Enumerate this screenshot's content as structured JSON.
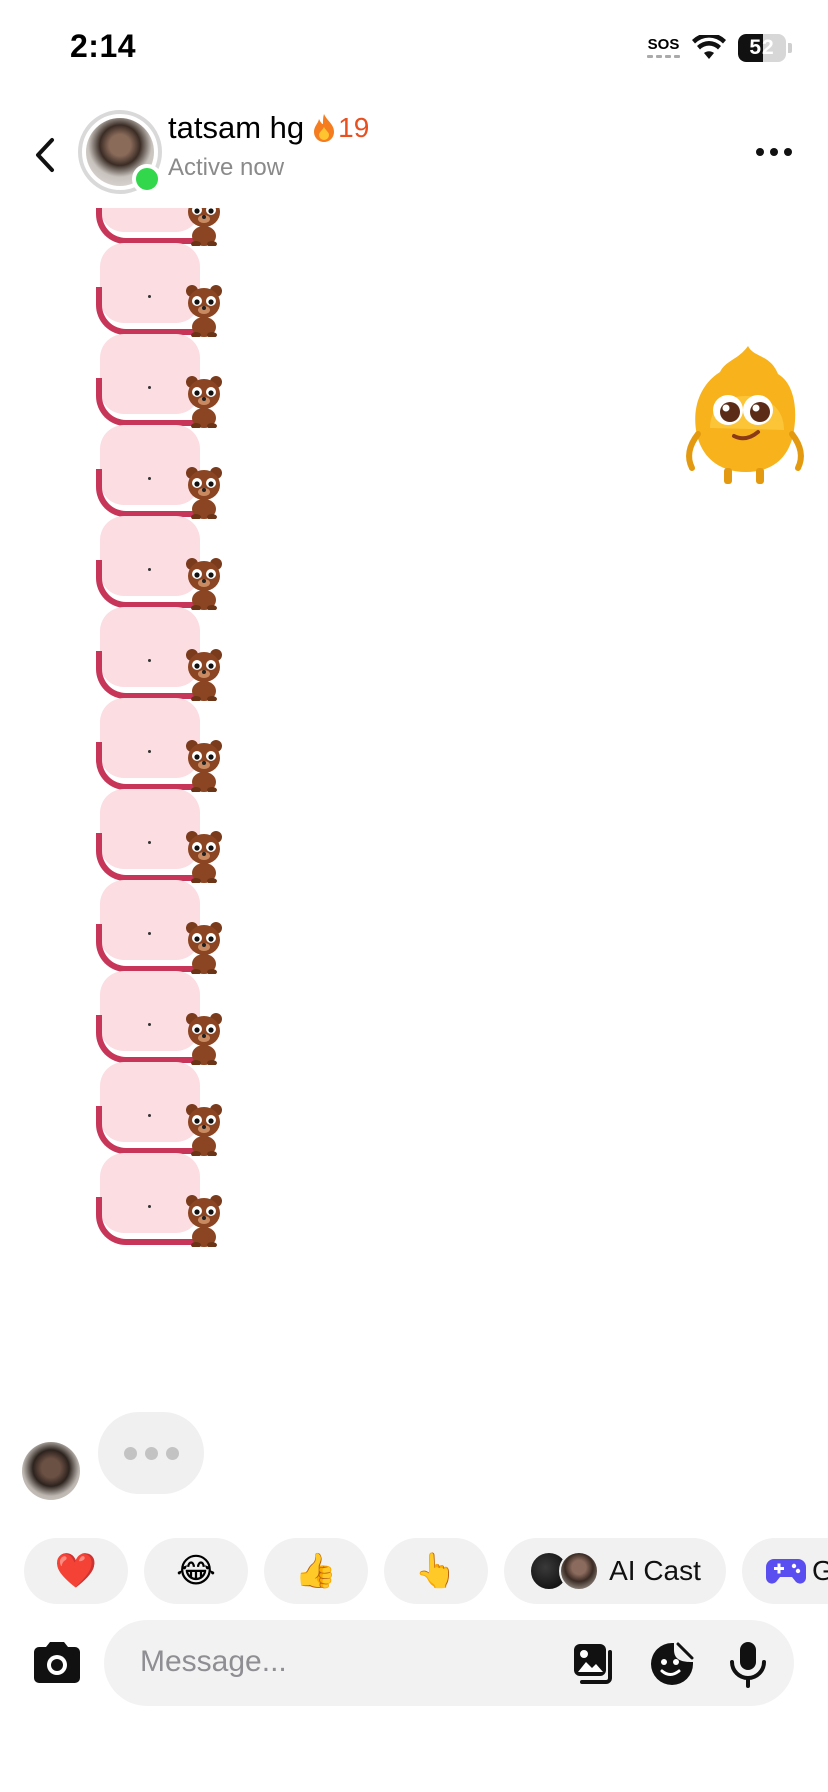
{
  "status_bar": {
    "time": "2:14",
    "sos": "SOS",
    "battery": "52",
    "battery_fraction": 0.52
  },
  "header": {
    "name": "tatsam hg",
    "streak_icon": "fire-icon",
    "streak_count": "19",
    "status": "Active now",
    "online": true
  },
  "messages": {
    "sticker_name": "bear-tongue-sticker",
    "sent_sticker_count": 12,
    "peer_sticker_name": "flame-mascot-sticker",
    "typing": true
  },
  "quick_replies": [
    {
      "kind": "emoji",
      "value": "❤️"
    },
    {
      "kind": "emoji",
      "value": "😂"
    },
    {
      "kind": "emoji",
      "value": "👍"
    },
    {
      "kind": "emoji",
      "value": "👆"
    },
    {
      "kind": "label",
      "value": "AI Cast"
    },
    {
      "kind": "label",
      "value": "G"
    }
  ],
  "input": {
    "placeholder": "Message...",
    "value": ""
  },
  "colors": {
    "online": "#32d74b",
    "streak": "#e8501f",
    "sticker_pink": "#fbdde2",
    "sticker_tongue": "#c73559"
  }
}
